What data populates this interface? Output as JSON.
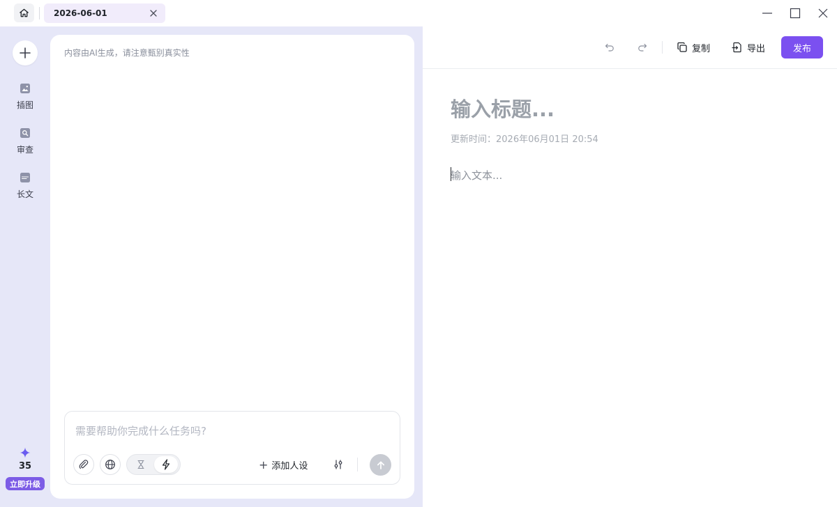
{
  "titlebar": {
    "tab_label": "2026-06-01"
  },
  "rail": {
    "items": [
      {
        "label": "插图",
        "icon": "image-icon"
      },
      {
        "label": "审查",
        "icon": "review-search-icon"
      },
      {
        "label": "长文",
        "icon": "long-text-icon"
      }
    ],
    "credits": "35",
    "upgrade_label": "立即升级"
  },
  "chat": {
    "notice": "内容由AI生成，请注意甄别真实性",
    "input_placeholder": "需要帮助你完成什么任务吗?",
    "add_persona_label": "添加人设"
  },
  "editor": {
    "copy_label": "复制",
    "export_label": "导出",
    "publish_label": "发布",
    "title_placeholder": "输入标题...",
    "updated_prefix": "更新时间：",
    "updated_time": "2026年06月01日 20:54",
    "body_placeholder": "输入文本..."
  },
  "colors": {
    "accent": "#7b50f0",
    "rail_bg": "#e6e7f8",
    "tab_bg": "#f1ecfb"
  }
}
